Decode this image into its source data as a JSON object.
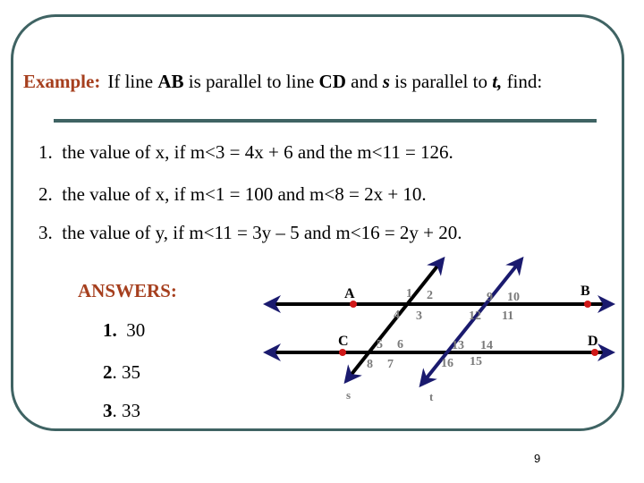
{
  "slide": {
    "page_number": "9",
    "colors": {
      "frame": "#3f6363",
      "accent": "#a63f1e",
      "transversal_t": "#1a1a6e",
      "point": "#d01818",
      "angle_label": "#7a7a7a"
    }
  },
  "header": {
    "lead": "Example:",
    "text_1": "If line ",
    "ab": "AB",
    "text_2": " is parallel to line ",
    "cd": "CD",
    "text_3": " and ",
    "s": "s",
    "text_4": " is parallel to ",
    "t": "t,",
    "text_5": " find:"
  },
  "questions": [
    {
      "num": "1.",
      "text": "the value of x, if m<3 = 4x + 6 and the m<11 = 126."
    },
    {
      "num": "2.",
      "text": "the value of x, if m<1 = 100 and m<8 = 2x + 10."
    },
    {
      "num": "3.",
      "text": "the value of y, if m<11 = 3y – 5 and m<16 = 2y + 20."
    }
  ],
  "answers": {
    "title": "ANSWERS:",
    "items": [
      {
        "num": "1.",
        "value": "30"
      },
      {
        "num": "2",
        "value": ". 35"
      },
      {
        "num": "3",
        "value": ". 33"
      }
    ]
  },
  "diagram": {
    "points": {
      "A": "A",
      "B": "B",
      "C": "C",
      "D": "D"
    },
    "line_labels": {
      "s": "s",
      "t": "t"
    },
    "angles": [
      "1",
      "2",
      "3",
      "4",
      "5",
      "6",
      "7",
      "8",
      "9",
      "10",
      "11",
      "12",
      "13",
      "14",
      "15",
      "16"
    ]
  }
}
